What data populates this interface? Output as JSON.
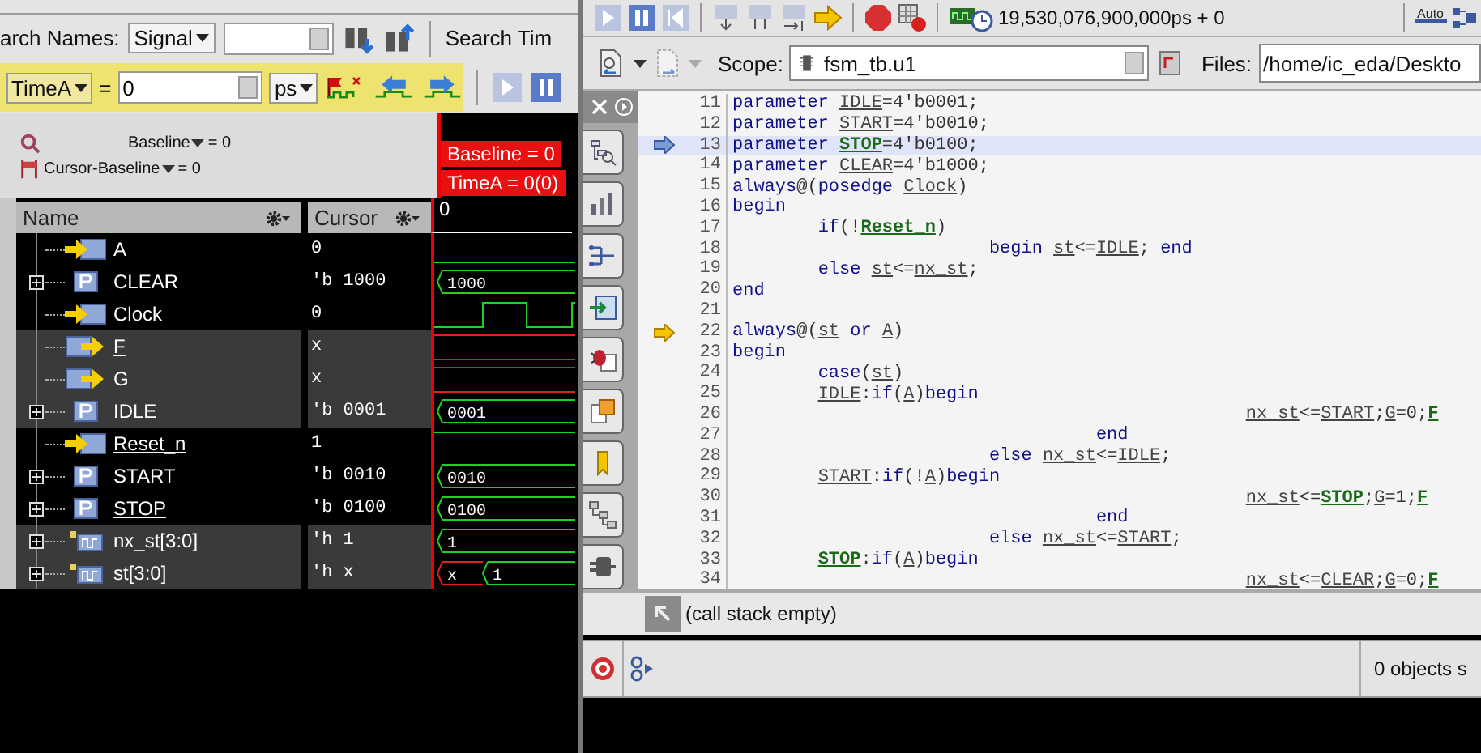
{
  "wave_window": {
    "search": {
      "label": "arch Names:",
      "type": "Signal",
      "time_label": "Search Tim"
    },
    "time_bar": {
      "marker": "TimeA",
      "equals": "=",
      "value": "0",
      "unit": "ps"
    },
    "baseline": {
      "label": "Baseline",
      "value": "= 0",
      "cursor_label": "Cursor-Baseline",
      "cursor_value": "= 0"
    },
    "markers": [
      "Baseline = 0",
      "TimeA = 0(0)"
    ],
    "columns": [
      "Name",
      "Cursor"
    ],
    "time_label": "0",
    "signals": [
      {
        "name": "A",
        "kind": "input",
        "expandable": false,
        "underlined": false,
        "highlighted": false,
        "cursor": "0",
        "wave": {
          "kind": "low"
        }
      },
      {
        "name": "CLEAR",
        "kind": "parameter",
        "expandable": true,
        "underlined": false,
        "highlighted": false,
        "cursor": "'b 1000",
        "wave": {
          "kind": "bus",
          "segments": [
            {
              "label": "1000",
              "unknown": false
            }
          ]
        }
      },
      {
        "name": "Clock",
        "kind": "input",
        "expandable": false,
        "underlined": false,
        "highlighted": false,
        "cursor": "0",
        "wave": {
          "kind": "clock"
        }
      },
      {
        "name": "F",
        "kind": "output",
        "expandable": false,
        "underlined": true,
        "highlighted": true,
        "cursor": "x",
        "wave": {
          "kind": "unknown"
        }
      },
      {
        "name": "G",
        "kind": "output",
        "expandable": false,
        "underlined": false,
        "highlighted": true,
        "cursor": "x",
        "wave": {
          "kind": "unknown"
        }
      },
      {
        "name": "IDLE",
        "kind": "parameter",
        "expandable": true,
        "underlined": false,
        "highlighted": true,
        "cursor": "'b 0001",
        "wave": {
          "kind": "bus",
          "segments": [
            {
              "label": "0001",
              "unknown": false
            }
          ]
        }
      },
      {
        "name": "Reset_n",
        "kind": "input",
        "expandable": false,
        "underlined": true,
        "highlighted": false,
        "cursor": "1",
        "wave": {
          "kind": "high"
        }
      },
      {
        "name": "START",
        "kind": "parameter",
        "expandable": true,
        "underlined": false,
        "highlighted": false,
        "cursor": "'b 0010",
        "wave": {
          "kind": "bus",
          "segments": [
            {
              "label": "0010",
              "unknown": false
            }
          ]
        }
      },
      {
        "name": "STOP",
        "kind": "parameter",
        "expandable": true,
        "underlined": true,
        "highlighted": false,
        "cursor": "'b 0100",
        "wave": {
          "kind": "bus",
          "segments": [
            {
              "label": "0100",
              "unknown": false
            }
          ]
        }
      },
      {
        "name": "nx_st[3:0]",
        "kind": "bus",
        "expandable": true,
        "underlined": false,
        "highlighted": true,
        "cursor": "'h 1",
        "wave": {
          "kind": "bus",
          "segments": [
            {
              "label": "1",
              "unknown": false
            }
          ]
        }
      },
      {
        "name": "st[3:0]",
        "kind": "bus",
        "expandable": true,
        "underlined": false,
        "highlighted": true,
        "cursor": "'h x",
        "wave": {
          "kind": "bus",
          "segments": [
            {
              "label": "x",
              "unknown": true
            },
            {
              "label": "1",
              "unknown": false
            }
          ]
        }
      }
    ]
  },
  "source_window": {
    "toolbar": {
      "time": "19,530,076,900,000ps + 0",
      "auto_label": "Auto"
    },
    "scope": {
      "label": "Scope:",
      "value": "fsm_tb.u1"
    },
    "files": {
      "label": "Files:",
      "value": "/home/ic_eda/Deskto"
    },
    "code_lines": [
      {
        "number": "11",
        "current": false,
        "caller": false,
        "tokens": [
          {
            "text": "parameter ",
            "kind": "kw"
          },
          {
            "text": "IDLE",
            "kind": "id"
          },
          {
            "text": "=4'b0001;",
            "kind": "txt"
          }
        ]
      },
      {
        "number": "12",
        "current": false,
        "caller": false,
        "tokens": [
          {
            "text": "parameter ",
            "kind": "kw"
          },
          {
            "text": "START",
            "kind": "id"
          },
          {
            "text": "=4'b0010;",
            "kind": "txt"
          }
        ]
      },
      {
        "number": "13",
        "current": true,
        "caller": false,
        "tokens": [
          {
            "text": "parameter ",
            "kind": "kw"
          },
          {
            "text": "STOP",
            "kind": "sig"
          },
          {
            "text": "=4'b0100;",
            "kind": "txt"
          }
        ]
      },
      {
        "number": "14",
        "current": false,
        "caller": false,
        "tokens": [
          {
            "text": "parameter ",
            "kind": "kw"
          },
          {
            "text": "CLEAR",
            "kind": "id"
          },
          {
            "text": "=4'b1000;",
            "kind": "txt"
          }
        ]
      },
      {
        "number": "15",
        "current": false,
        "caller": false,
        "tokens": [
          {
            "text": "always",
            "kind": "kw"
          },
          {
            "text": "@(",
            "kind": "txt"
          },
          {
            "text": "posedge ",
            "kind": "kw"
          },
          {
            "text": "Clock",
            "kind": "id"
          },
          {
            "text": ")",
            "kind": "txt"
          }
        ]
      },
      {
        "number": "16",
        "current": false,
        "caller": false,
        "tokens": [
          {
            "text": "begin",
            "kind": "kw"
          }
        ]
      },
      {
        "number": "17",
        "current": false,
        "caller": false,
        "tokens": [
          {
            "text": "        if",
            "kind": "kw"
          },
          {
            "text": "(!",
            "kind": "txt"
          },
          {
            "text": "Reset_n",
            "kind": "sig"
          },
          {
            "text": ")",
            "kind": "txt"
          }
        ]
      },
      {
        "number": "18",
        "current": false,
        "caller": false,
        "tokens": [
          {
            "text": "                        begin ",
            "kind": "kw"
          },
          {
            "text": "st",
            "kind": "id"
          },
          {
            "text": "<=",
            "kind": "txt"
          },
          {
            "text": "IDLE",
            "kind": "id"
          },
          {
            "text": "; ",
            "kind": "txt"
          },
          {
            "text": "end",
            "kind": "kw"
          }
        ]
      },
      {
        "number": "19",
        "current": false,
        "caller": false,
        "tokens": [
          {
            "text": "        else ",
            "kind": "kw"
          },
          {
            "text": "st",
            "kind": "id"
          },
          {
            "text": "<=",
            "kind": "txt"
          },
          {
            "text": "nx_st",
            "kind": "id"
          },
          {
            "text": ";",
            "kind": "txt"
          }
        ]
      },
      {
        "number": "20",
        "current": false,
        "caller": false,
        "tokens": [
          {
            "text": "end",
            "kind": "kw"
          }
        ]
      },
      {
        "number": "21",
        "current": false,
        "caller": false
      },
      {
        "number": "22",
        "current": false,
        "caller": true,
        "tokens": [
          {
            "text": "always",
            "kind": "kw"
          },
          {
            "text": "@(",
            "kind": "txt"
          },
          {
            "text": "st",
            "kind": "id"
          },
          {
            "text": " or ",
            "kind": "kw"
          },
          {
            "text": "A",
            "kind": "id"
          },
          {
            "text": ")",
            "kind": "txt"
          }
        ]
      },
      {
        "number": "23",
        "current": false,
        "caller": false,
        "tokens": [
          {
            "text": "begin",
            "kind": "kw"
          }
        ]
      },
      {
        "number": "24",
        "current": false,
        "caller": false,
        "tokens": [
          {
            "text": "        case",
            "kind": "kw"
          },
          {
            "text": "(",
            "kind": "txt"
          },
          {
            "text": "st",
            "kind": "id"
          },
          {
            "text": ")",
            "kind": "txt"
          }
        ]
      },
      {
        "number": "25",
        "current": false,
        "caller": false,
        "tokens": [
          {
            "text": "        IDLE",
            "kind": "id"
          },
          {
            "text": ":",
            "kind": "txt"
          },
          {
            "text": "if",
            "kind": "kw"
          },
          {
            "text": "(",
            "kind": "txt"
          },
          {
            "text": "A",
            "kind": "id"
          },
          {
            "text": ")",
            "kind": "txt"
          },
          {
            "text": "begin",
            "kind": "kw"
          }
        ]
      },
      {
        "number": "26",
        "current": false,
        "caller": false,
        "tokens": [
          {
            "text": "                                                nx_st",
            "kind": "id"
          },
          {
            "text": "<=",
            "kind": "txt"
          },
          {
            "text": "START",
            "kind": "id"
          },
          {
            "text": ";",
            "kind": "txt"
          },
          {
            "text": "G",
            "kind": "id"
          },
          {
            "text": "=0;",
            "kind": "txt"
          },
          {
            "text": "F",
            "kind": "sig"
          }
        ]
      },
      {
        "number": "27",
        "current": false,
        "caller": false,
        "tokens": [
          {
            "text": "                                  end",
            "kind": "kw"
          }
        ]
      },
      {
        "number": "28",
        "current": false,
        "caller": false,
        "tokens": [
          {
            "text": "                        else ",
            "kind": "kw"
          },
          {
            "text": "nx_st",
            "kind": "id"
          },
          {
            "text": "<=",
            "kind": "txt"
          },
          {
            "text": "IDLE",
            "kind": "id"
          },
          {
            "text": ";",
            "kind": "txt"
          }
        ]
      },
      {
        "number": "29",
        "current": false,
        "caller": false,
        "tokens": [
          {
            "text": "        START",
            "kind": "id"
          },
          {
            "text": ":",
            "kind": "txt"
          },
          {
            "text": "if",
            "kind": "kw"
          },
          {
            "text": "(!",
            "kind": "txt"
          },
          {
            "text": "A",
            "kind": "id"
          },
          {
            "text": ")",
            "kind": "txt"
          },
          {
            "text": "begin",
            "kind": "kw"
          }
        ]
      },
      {
        "number": "30",
        "current": false,
        "caller": false,
        "tokens": [
          {
            "text": "                                                nx_st",
            "kind": "id"
          },
          {
            "text": "<=",
            "kind": "txt"
          },
          {
            "text": "STOP",
            "kind": "sig"
          },
          {
            "text": ";",
            "kind": "txt"
          },
          {
            "text": "G",
            "kind": "id"
          },
          {
            "text": "=1;",
            "kind": "txt"
          },
          {
            "text": "F",
            "kind": "sig"
          }
        ]
      },
      {
        "number": "31",
        "current": false,
        "caller": false,
        "tokens": [
          {
            "text": "                                  end",
            "kind": "kw"
          }
        ]
      },
      {
        "number": "32",
        "current": false,
        "caller": false,
        "tokens": [
          {
            "text": "                        else ",
            "kind": "kw"
          },
          {
            "text": "nx_st",
            "kind": "id"
          },
          {
            "text": "<=",
            "kind": "txt"
          },
          {
            "text": "START",
            "kind": "id"
          },
          {
            "text": ";",
            "kind": "txt"
          }
        ]
      },
      {
        "number": "33",
        "current": false,
        "caller": false,
        "tokens": [
          {
            "text": "        STOP",
            "kind": "sig"
          },
          {
            "text": ":",
            "kind": "txt"
          },
          {
            "text": "if",
            "kind": "kw"
          },
          {
            "text": "(",
            "kind": "txt"
          },
          {
            "text": "A",
            "kind": "id"
          },
          {
            "text": ")",
            "kind": "txt"
          },
          {
            "text": "begin",
            "kind": "kw"
          }
        ]
      },
      {
        "number": "34",
        "current": false,
        "caller": false,
        "tokens": [
          {
            "text": "                                                nx_st",
            "kind": "id"
          },
          {
            "text": "<=",
            "kind": "txt"
          },
          {
            "text": "CLEAR",
            "kind": "id"
          },
          {
            "text": ";",
            "kind": "txt"
          },
          {
            "text": "G",
            "kind": "id"
          },
          {
            "text": "=0;",
            "kind": "txt"
          },
          {
            "text": "F",
            "kind": "sig"
          }
        ]
      }
    ],
    "call_stack": "(call stack empty)",
    "status": "0 objects s"
  }
}
